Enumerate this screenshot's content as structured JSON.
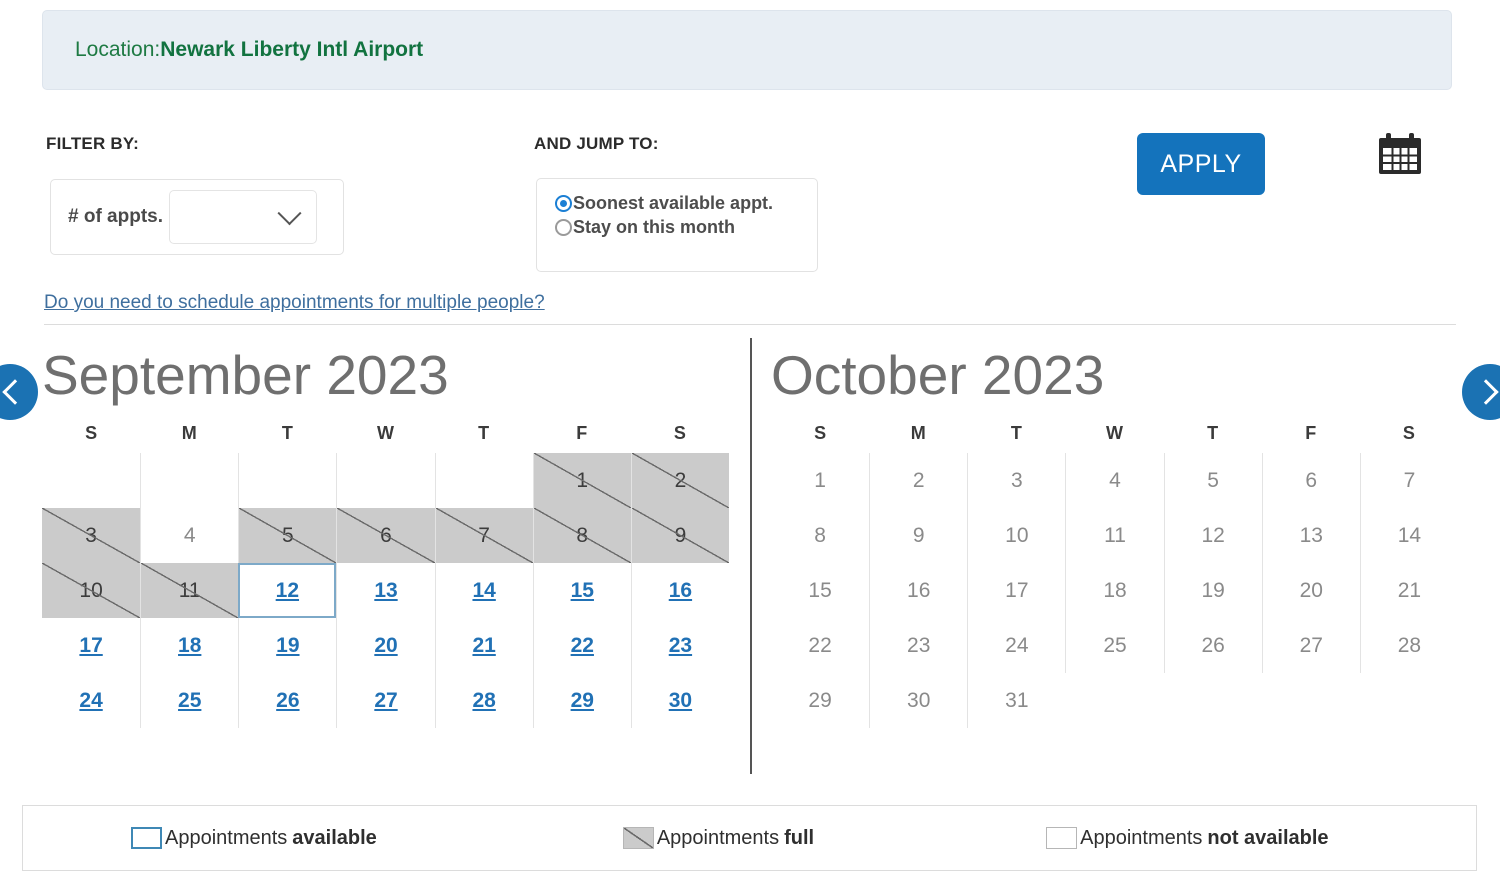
{
  "location": {
    "label": "Location:",
    "value": "Newark Liberty Intl Airport"
  },
  "filters": {
    "filter_heading": "FILTER BY:",
    "appts_label": "# of appts.",
    "appts_value": "",
    "appts_placeholder": ""
  },
  "jump": {
    "heading": "AND JUMP TO:",
    "options": [
      {
        "label": "Soonest available appt.",
        "selected": true
      },
      {
        "label": "Stay on this month",
        "selected": false
      }
    ]
  },
  "actions": {
    "apply_label": "APPLY",
    "calendar_icon": "calendar-icon",
    "prev_icon": "chevron-left-icon",
    "next_icon": "chevron-right-icon"
  },
  "multi_link": "Do you need to schedule appointments for multiple people?",
  "day_headers": [
    "S",
    "M",
    "T",
    "W",
    "T",
    "F",
    "S"
  ],
  "months": [
    {
      "title": "September 2023",
      "lead_blanks": 5,
      "days": [
        {
          "n": "1",
          "state": "full"
        },
        {
          "n": "2",
          "state": "full"
        },
        {
          "n": "3",
          "state": "full"
        },
        {
          "n": "4",
          "state": "unavailable"
        },
        {
          "n": "5",
          "state": "full"
        },
        {
          "n": "6",
          "state": "full"
        },
        {
          "n": "7",
          "state": "full"
        },
        {
          "n": "8",
          "state": "full"
        },
        {
          "n": "9",
          "state": "full"
        },
        {
          "n": "10",
          "state": "full"
        },
        {
          "n": "11",
          "state": "full"
        },
        {
          "n": "12",
          "state": "available",
          "selected": true
        },
        {
          "n": "13",
          "state": "available"
        },
        {
          "n": "14",
          "state": "available"
        },
        {
          "n": "15",
          "state": "available"
        },
        {
          "n": "16",
          "state": "available"
        },
        {
          "n": "17",
          "state": "available"
        },
        {
          "n": "18",
          "state": "available"
        },
        {
          "n": "19",
          "state": "available"
        },
        {
          "n": "20",
          "state": "available"
        },
        {
          "n": "21",
          "state": "available"
        },
        {
          "n": "22",
          "state": "available"
        },
        {
          "n": "23",
          "state": "available"
        },
        {
          "n": "24",
          "state": "available"
        },
        {
          "n": "25",
          "state": "available"
        },
        {
          "n": "26",
          "state": "available"
        },
        {
          "n": "27",
          "state": "available"
        },
        {
          "n": "28",
          "state": "available"
        },
        {
          "n": "29",
          "state": "available"
        },
        {
          "n": "30",
          "state": "available"
        }
      ]
    },
    {
      "title": "October 2023",
      "lead_blanks": 0,
      "days": [
        {
          "n": "1",
          "state": "unavailable"
        },
        {
          "n": "2",
          "state": "unavailable"
        },
        {
          "n": "3",
          "state": "unavailable"
        },
        {
          "n": "4",
          "state": "unavailable"
        },
        {
          "n": "5",
          "state": "unavailable"
        },
        {
          "n": "6",
          "state": "unavailable"
        },
        {
          "n": "7",
          "state": "unavailable"
        },
        {
          "n": "8",
          "state": "unavailable"
        },
        {
          "n": "9",
          "state": "unavailable"
        },
        {
          "n": "10",
          "state": "unavailable"
        },
        {
          "n": "11",
          "state": "unavailable"
        },
        {
          "n": "12",
          "state": "unavailable"
        },
        {
          "n": "13",
          "state": "unavailable"
        },
        {
          "n": "14",
          "state": "unavailable"
        },
        {
          "n": "15",
          "state": "unavailable"
        },
        {
          "n": "16",
          "state": "unavailable"
        },
        {
          "n": "17",
          "state": "unavailable"
        },
        {
          "n": "18",
          "state": "unavailable"
        },
        {
          "n": "19",
          "state": "unavailable"
        },
        {
          "n": "20",
          "state": "unavailable"
        },
        {
          "n": "21",
          "state": "unavailable"
        },
        {
          "n": "22",
          "state": "unavailable"
        },
        {
          "n": "23",
          "state": "unavailable"
        },
        {
          "n": "24",
          "state": "unavailable"
        },
        {
          "n": "25",
          "state": "unavailable"
        },
        {
          "n": "26",
          "state": "unavailable"
        },
        {
          "n": "27",
          "state": "unavailable"
        },
        {
          "n": "28",
          "state": "unavailable"
        },
        {
          "n": "29",
          "state": "unavailable"
        },
        {
          "n": "30",
          "state": "unavailable"
        },
        {
          "n": "31",
          "state": "unavailable"
        }
      ]
    }
  ],
  "legend": [
    {
      "prefix": "Appointments",
      "strong": "available",
      "swatch": "available"
    },
    {
      "prefix": "Appointments",
      "strong": "full",
      "swatch": "full"
    },
    {
      "prefix": "Appointments",
      "strong": "not available",
      "swatch": "not-available"
    }
  ],
  "colors": {
    "accent_blue": "#1473bc",
    "link_blue": "#2171b5",
    "location_green": "#127340",
    "full_grey": "#cbcbcb",
    "banner_bg": "#e8eef4"
  }
}
